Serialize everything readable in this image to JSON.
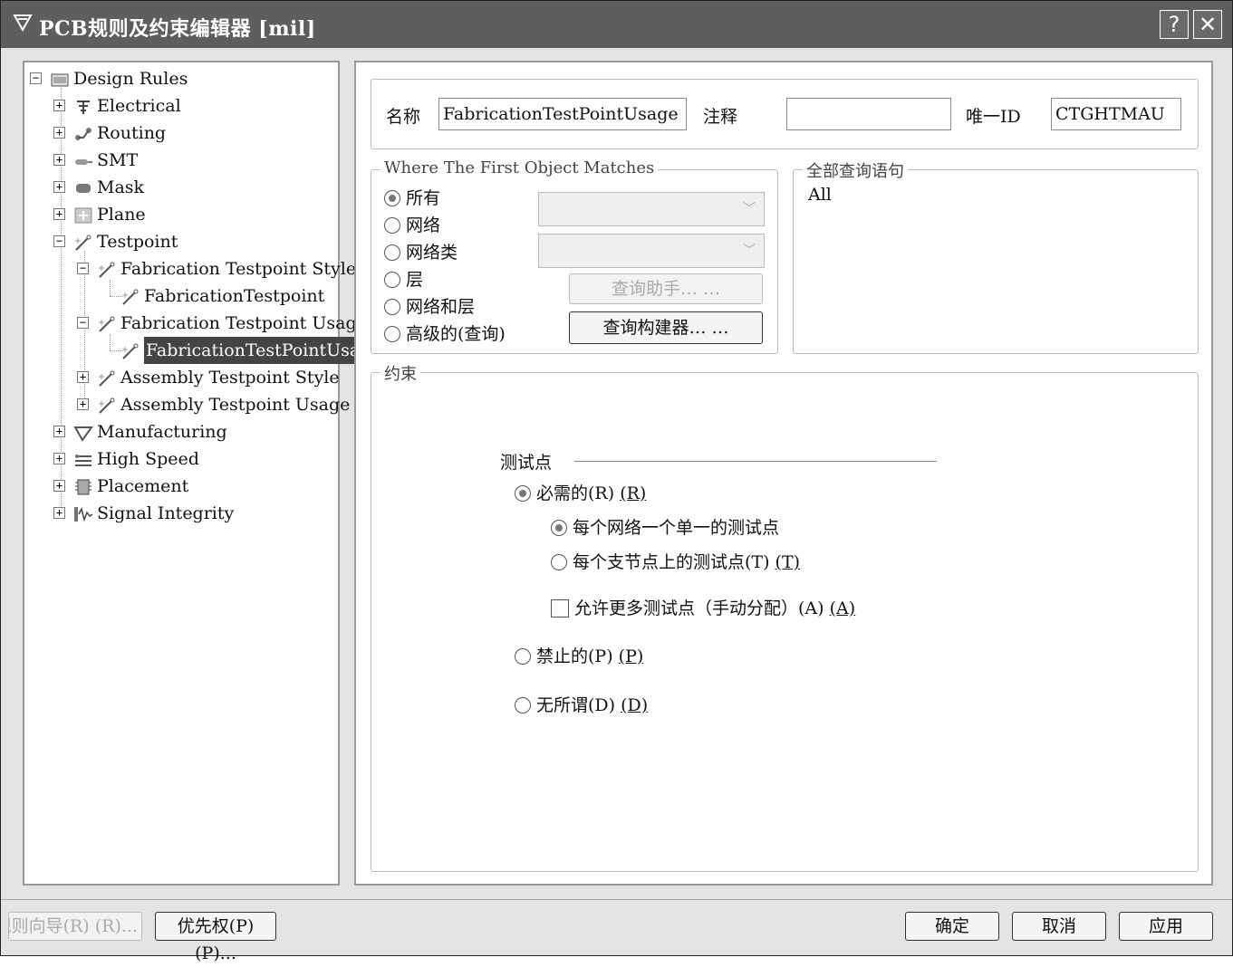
{
  "window": {
    "title": "PCB规则及约束编辑器 [mil]",
    "help_button": "?",
    "close_button": "✕"
  },
  "tree": {
    "items": [
      {
        "label": "Design Rules",
        "expander": "−",
        "icon": "design-rules-icon"
      },
      {
        "label": "Electrical",
        "expander": "+",
        "icon": "electrical-icon"
      },
      {
        "label": "Routing",
        "expander": "+",
        "icon": "routing-icon"
      },
      {
        "label": "SMT",
        "expander": "+",
        "icon": "smt-icon"
      },
      {
        "label": "Mask",
        "expander": "+",
        "icon": "mask-icon"
      },
      {
        "label": "Plane",
        "expander": "+",
        "icon": "plane-icon"
      },
      {
        "label": "Testpoint",
        "expander": "−",
        "icon": "testpoint-icon"
      },
      {
        "label": "Fabrication Testpoint Style",
        "expander": "−",
        "icon": "testpoint-icon"
      },
      {
        "label": "FabricationTestpoint",
        "expander": "",
        "icon": "testpoint-icon"
      },
      {
        "label": "Fabrication Testpoint Usage",
        "expander": "−",
        "icon": "testpoint-icon"
      },
      {
        "label": "FabricationTestPointUsag",
        "expander": "",
        "icon": "testpoint-icon",
        "selected": true
      },
      {
        "label": "Assembly Testpoint Style",
        "expander": "+",
        "icon": "testpoint-icon"
      },
      {
        "label": "Assembly Testpoint Usage",
        "expander": "+",
        "icon": "testpoint-icon"
      },
      {
        "label": "Manufacturing",
        "expander": "+",
        "icon": "manufacturing-icon"
      },
      {
        "label": "High Speed",
        "expander": "+",
        "icon": "high-speed-icon"
      },
      {
        "label": "Placement",
        "expander": "+",
        "icon": "placement-icon"
      },
      {
        "label": "Signal Integrity",
        "expander": "+",
        "icon": "signal-integrity-icon"
      }
    ]
  },
  "rule_header": {
    "name_label": "名称",
    "name_value": "FabricationTestPointUsage",
    "comment_label": "注释",
    "comment_value": "",
    "uid_label": "唯一ID",
    "uid_value": "CTGHTMAU"
  },
  "where": {
    "legend": "Where The First Object Matches",
    "options": [
      {
        "label": "所有",
        "checked": true
      },
      {
        "label": "网络",
        "checked": false
      },
      {
        "label": "网络类",
        "checked": false
      },
      {
        "label": "层",
        "checked": false
      },
      {
        "label": "网络和层",
        "checked": false
      },
      {
        "label": "高级的(查询)",
        "checked": false
      }
    ],
    "query_helper_button": "查询助手… …",
    "query_builder_button": "查询构建器… …"
  },
  "full_query": {
    "legend": "全部查询语句",
    "text": "All"
  },
  "constraints": {
    "legend": "约束",
    "section_title": "测试点",
    "required": {
      "label": "必需的(R)",
      "mnemonic": "(R)",
      "checked": true
    },
    "per_net": {
      "label": "每个网络一个单一的测试点",
      "checked": true
    },
    "per_node": {
      "label": "每个支节点上的测试点(T)",
      "mnemonic": "(T)",
      "checked": false
    },
    "allow_more": {
      "label": "允许更多测试点（手动分配）(A)",
      "mnemonic": "(A)",
      "checked": false
    },
    "prohibited": {
      "label": "禁止的(P)",
      "mnemonic": "(P)",
      "checked": false
    },
    "dont_care": {
      "label": "无所谓(D)",
      "mnemonic": "(D)",
      "checked": false
    }
  },
  "footer": {
    "wizard_button": "规则向导(R) (R)...",
    "priority_button": "优先权(P) (P)...",
    "ok_button": "确定",
    "cancel_button": "取消",
    "apply_button": "应用"
  },
  "colors": {
    "titlebar": "#5e5e5e",
    "selection": "#444444",
    "dialog_bg": "#e4e4e4"
  }
}
